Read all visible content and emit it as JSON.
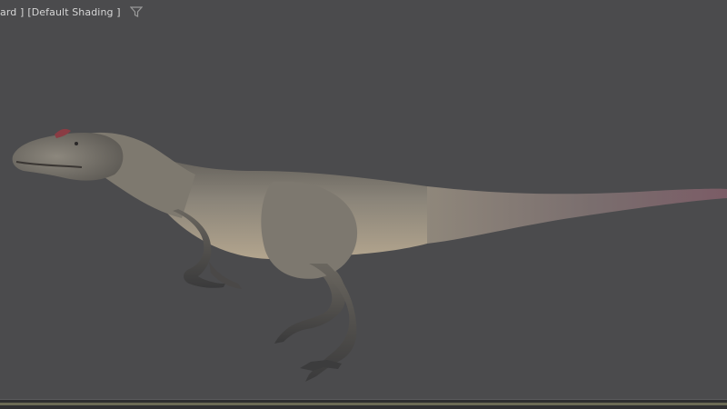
{
  "viewport": {
    "label_view": "ard ]",
    "label_shading": "[Default Shading ]",
    "filter_icon": "funnel-icon"
  },
  "colors": {
    "background": "#4b4b4d",
    "label_text": "#d6d6d6",
    "bottom_strip": "#2f2f31"
  }
}
